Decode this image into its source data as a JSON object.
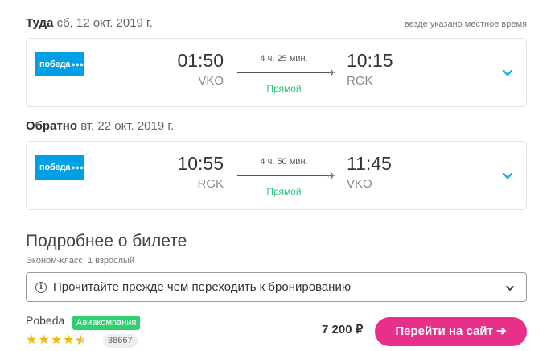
{
  "outbound": {
    "label": "Туда",
    "date": "сб, 12 окт. 2019 г.",
    "tz_note": "везде указано местное время",
    "airline_logo": "победа",
    "depart_time": "01:50",
    "depart_code": "VKO",
    "arrive_time": "10:15",
    "arrive_code": "RGK",
    "duration": "4 ч. 25 мин.",
    "stops": "Прямой"
  },
  "inbound": {
    "label": "Обратно",
    "date": "вт, 22 окт. 2019 г.",
    "airline_logo": "победа",
    "depart_time": "10:55",
    "depart_code": "RGK",
    "arrive_time": "11:45",
    "arrive_code": "VKO",
    "duration": "4 ч. 50 мин.",
    "stops": "Прямой"
  },
  "details": {
    "title": "Подробнее о билете",
    "subtitle": "Эконом-класс, 1 взрослый",
    "notice": "Прочитайте прежде чем переходить к бронированию"
  },
  "offer": {
    "seller": "Pobeda",
    "badge": "Авиакомпания",
    "rating": 4.5,
    "rating_max": 5,
    "reviews": "38667",
    "price": "7 200 ₽",
    "cta": "Перейти на сайт ➔"
  },
  "colors": {
    "logo": "#00a0e6",
    "accent": "#e8308a",
    "direct": "#29c47a",
    "chevron": "#1ab0d6",
    "badge": "#30d070",
    "star": "#f5b800"
  },
  "icons": {
    "expand": "chevron-down-icon",
    "plane": "plane-icon",
    "info": "info-icon",
    "star": "star-icon"
  }
}
